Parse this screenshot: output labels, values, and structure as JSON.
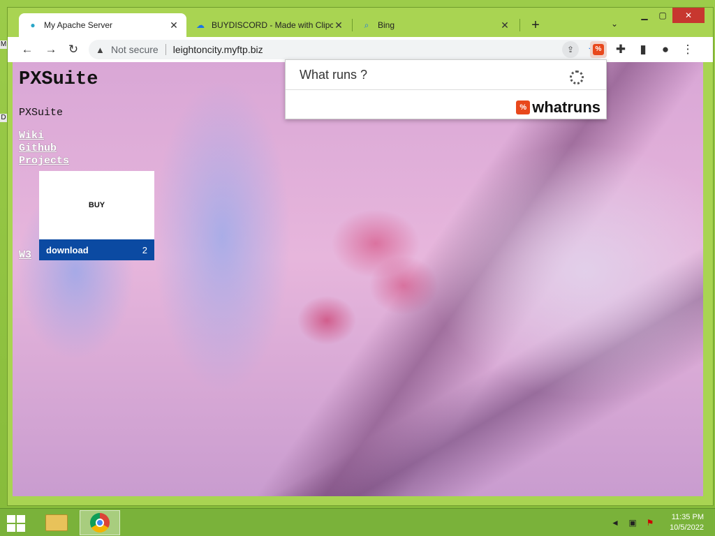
{
  "browser": {
    "tabs": [
      {
        "title": "My Apache Server",
        "icon": "globe-icon",
        "active": true
      },
      {
        "title": "BUYDISCORD - Made with Clipc",
        "icon": "cloud-icon",
        "active": false
      },
      {
        "title": "Bing",
        "icon": "search-icon",
        "active": false
      }
    ],
    "new_tab_label": "+",
    "address": {
      "security_label": "Not secure",
      "url": "leightoncity.myftp.biz"
    }
  },
  "desktop": {
    "edge_labels": [
      "M",
      "D"
    ]
  },
  "page": {
    "heading": "PXSuite",
    "subtitle": "PXSuite",
    "links": [
      "Wiki",
      "Github",
      "Projects"
    ],
    "w3_link": "W3",
    "buy_card": {
      "buy_label": "BUY",
      "download_label": "download",
      "download_count": "2"
    }
  },
  "popup": {
    "title": "What runs ?",
    "brand": "whatruns",
    "brand_color": "#e8481c"
  },
  "taskbar": {
    "apps": [
      "file-explorer-icon",
      "chrome-icon"
    ],
    "time": "11:35 PM",
    "date": "10/5/2022"
  }
}
